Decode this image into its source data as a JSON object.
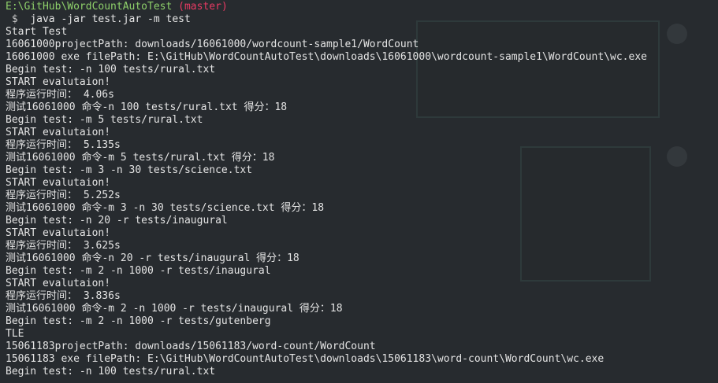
{
  "prompt": {
    "path": "E:\\GitHub\\WordCountAutoTest",
    "branch": "(master)",
    "symbol": "$",
    "command": "java -jar test.jar -m test"
  },
  "output_lines": [
    "Start Test",
    "16061000projectPath: downloads/16061000/wordcount-sample1/WordCount",
    "16061000 exe filePath: E:\\GitHub\\WordCountAutoTest\\downloads\\16061000\\wordcount-sample1\\WordCount\\wc.exe",
    "Begin test: -n 100 tests/rural.txt",
    "START evalutaion!",
    "程序运行时间： 4.06s",
    "测试16061000 命令-n 100 tests/rural.txt 得分：18",
    "Begin test: -m 5 tests/rural.txt",
    "START evalutaion!",
    "程序运行时间： 5.135s",
    "测试16061000 命令-m 5 tests/rural.txt 得分：18",
    "Begin test: -m 3 -n 30 tests/science.txt",
    "START evalutaion!",
    "程序运行时间： 5.252s",
    "测试16061000 命令-m 3 -n 30 tests/science.txt 得分：18",
    "Begin test: -n 20 -r tests/inaugural",
    "START evalutaion!",
    "程序运行时间： 3.625s",
    "测试16061000 命令-n 20 -r tests/inaugural 得分：18",
    "Begin test: -m 2 -n 1000 -r tests/inaugural",
    "START evalutaion!",
    "程序运行时间： 3.836s",
    "测试16061000 命令-m 2 -n 1000 -r tests/inaugural 得分：18",
    "Begin test: -m 2 -n 1000 -r tests/gutenberg",
    "TLE",
    "15061183projectPath: downloads/15061183/word-count/WordCount",
    "15061183 exe filePath: E:\\GitHub\\WordCountAutoTest\\downloads\\15061183\\word-count\\WordCount\\wc.exe",
    "Begin test: -n 100 tests/rural.txt"
  ],
  "colors": {
    "background": "#272b2f",
    "text": "#e4e4e4",
    "prompt_path": "#8ed06a",
    "prompt_branch": "#e83a63"
  }
}
